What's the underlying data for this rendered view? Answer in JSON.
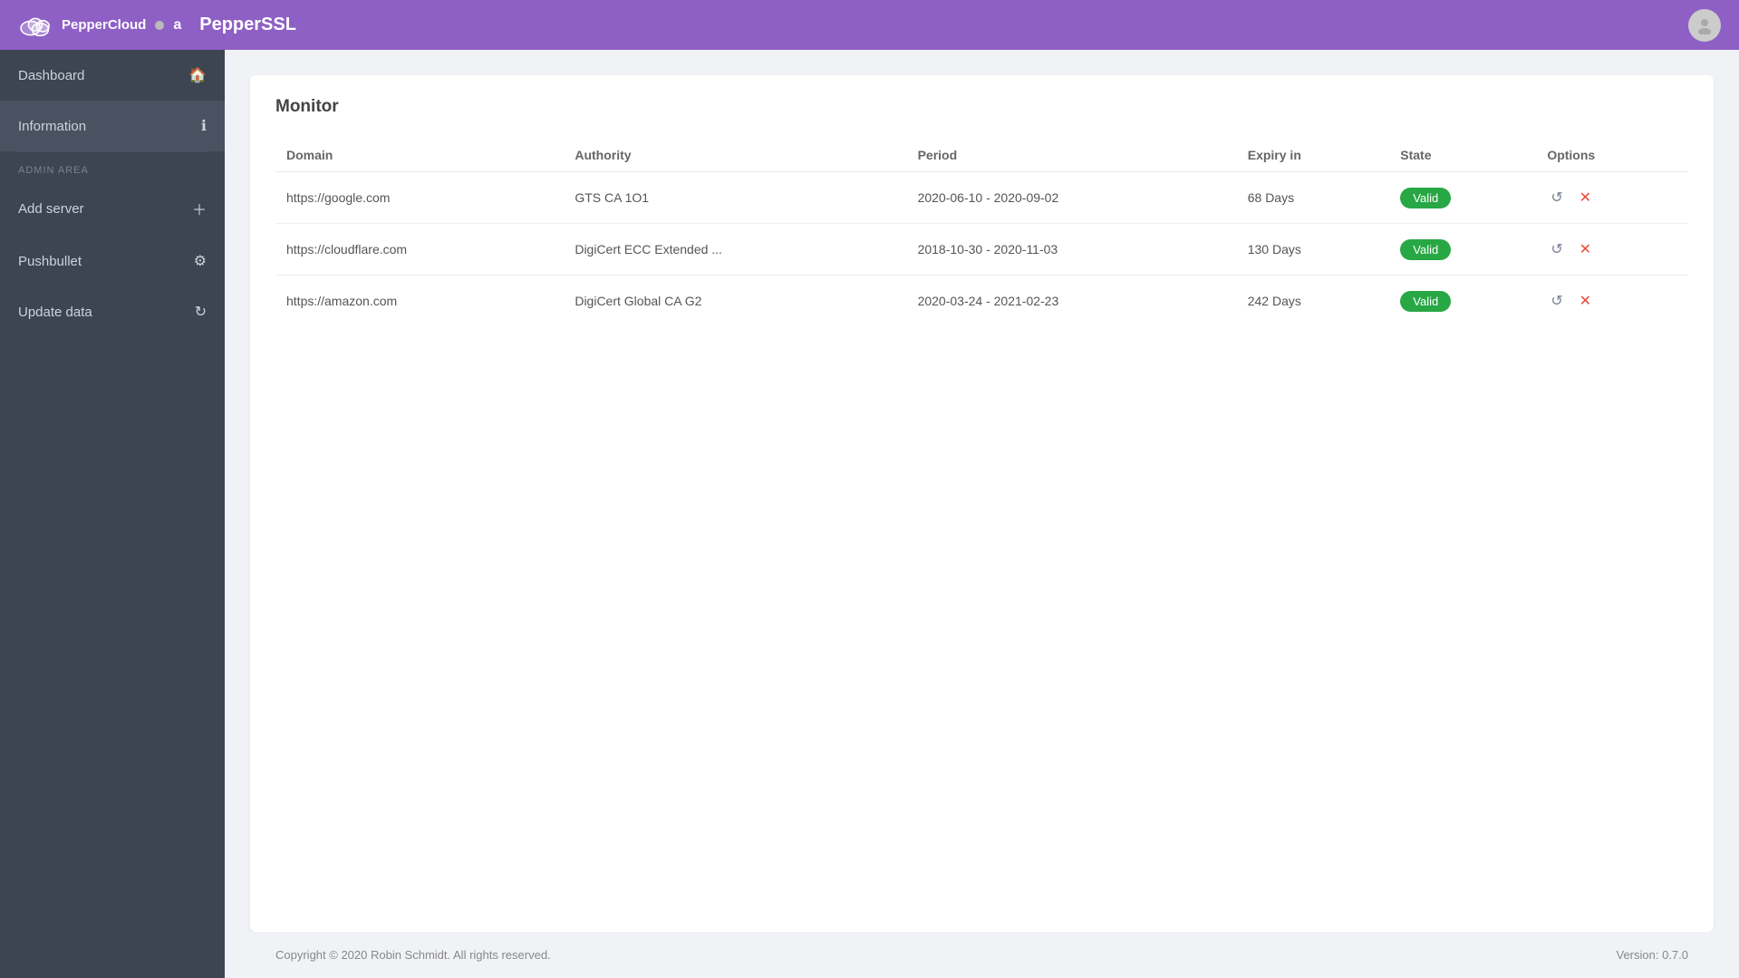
{
  "topnav": {
    "logo_alt": "PepperCloud",
    "dot_color": "#bbbbbb",
    "letter": "a",
    "title": "PepperSSL"
  },
  "sidebar": {
    "items": [
      {
        "id": "dashboard",
        "label": "Dashboard",
        "icon": "🏠"
      },
      {
        "id": "information",
        "label": "Information",
        "icon": "ℹ"
      }
    ],
    "admin_area_label": "ADMIN AREA",
    "admin_items": [
      {
        "id": "add-server",
        "label": "Add server",
        "icon": "+"
      },
      {
        "id": "pushbullet",
        "label": "Pushbullet",
        "icon": "⚙"
      },
      {
        "id": "update-data",
        "label": "Update data",
        "icon": "↻"
      }
    ]
  },
  "main": {
    "card_title": "Monitor",
    "table": {
      "headers": [
        "Domain",
        "Authority",
        "Period",
        "Expiry in",
        "State",
        "Options"
      ],
      "rows": [
        {
          "domain": "https://google.com",
          "authority": "GTS CA 1O1",
          "period": "2020-06-10 - 2020-09-02",
          "expiry": "68 Days",
          "state": "Valid"
        },
        {
          "domain": "https://cloudflare.com",
          "authority": "DigiCert ECC Extended ...",
          "period": "2018-10-30 - 2020-11-03",
          "expiry": "130 Days",
          "state": "Valid"
        },
        {
          "domain": "https://amazon.com",
          "authority": "DigiCert Global CA G2",
          "period": "2020-03-24 - 2021-02-23",
          "expiry": "242 Days",
          "state": "Valid"
        }
      ]
    }
  },
  "footer": {
    "copyright": "Copyright © 2020 Robin Schmidt. All rights reserved.",
    "version": "Version: 0.7.0"
  }
}
